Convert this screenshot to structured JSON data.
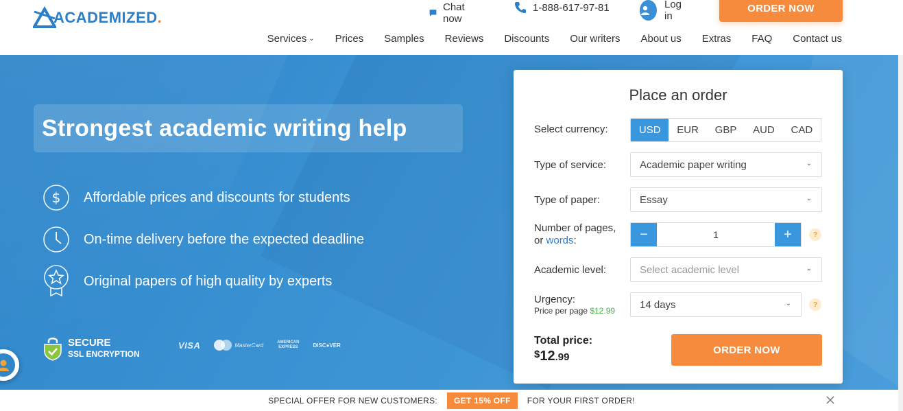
{
  "header": {
    "logo_text": "ACADEMIZED",
    "logo_dot": ".",
    "chat_label": "Chat now",
    "phone": "1-888-617-97-81",
    "login_label": "Log in",
    "order_now": "ORDER NOW",
    "nav": {
      "services": "Services",
      "prices": "Prices",
      "samples": "Samples",
      "reviews": "Reviews",
      "discounts": "Discounts",
      "writers": "Our writers",
      "about": "About us",
      "extras": "Extras",
      "faq": "FAQ",
      "contact": "Contact us"
    }
  },
  "hero": {
    "headline": "Strongest academic writing help",
    "features": [
      {
        "icon": "dollar-icon",
        "text": "Affordable prices and discounts for students"
      },
      {
        "icon": "clock-icon",
        "text": "On-time delivery before the expected deadline"
      },
      {
        "icon": "star-badge-icon",
        "text": "Original papers of high quality by experts"
      }
    ],
    "secure_line1": "SECURE",
    "secure_line2": "SSL ENCRYPTION",
    "payments": {
      "visa": "VISA",
      "mastercard": "MasterCard",
      "amex_line1": "AMERICAN",
      "amex_line2": "EXPRESS",
      "discover": "DISC●VER"
    }
  },
  "order_form": {
    "title": "Place an order",
    "currency_label": "Select currency:",
    "currencies": [
      "USD",
      "EUR",
      "GBP",
      "AUD",
      "CAD"
    ],
    "selected_currency": "USD",
    "service_label": "Type of service:",
    "service_value": "Academic paper writing",
    "paper_label": "Type of paper:",
    "paper_value": "Essay",
    "pages_label_line1": "Number of pages,",
    "pages_label_or": "or",
    "pages_label_words": "words",
    "pages_label_colon": ":",
    "pages_value": "1",
    "minus": "−",
    "plus": "+",
    "help_mark": "?",
    "level_label": "Academic level:",
    "level_placeholder": "Select academic level",
    "urgency_label": "Urgency:",
    "price_per_page_label": "Price per page",
    "price_per_page_value": "$12.99",
    "urgency_value": "14 days",
    "total_label": "Total price:",
    "total_currency": "$",
    "total_int": "12",
    "total_dec": ".99",
    "order_button": "ORDER NOW"
  },
  "offer_bar": {
    "left_text": "SPECIAL OFFER FOR NEW CUSTOMERS:",
    "badge": "GET 15% OFF",
    "right_text": "FOR YOUR FIRST ORDER!"
  },
  "colors": {
    "brand_blue": "#2b7fc9",
    "accent_orange": "#f68b3d",
    "hero_blue": "#3b93d4"
  }
}
